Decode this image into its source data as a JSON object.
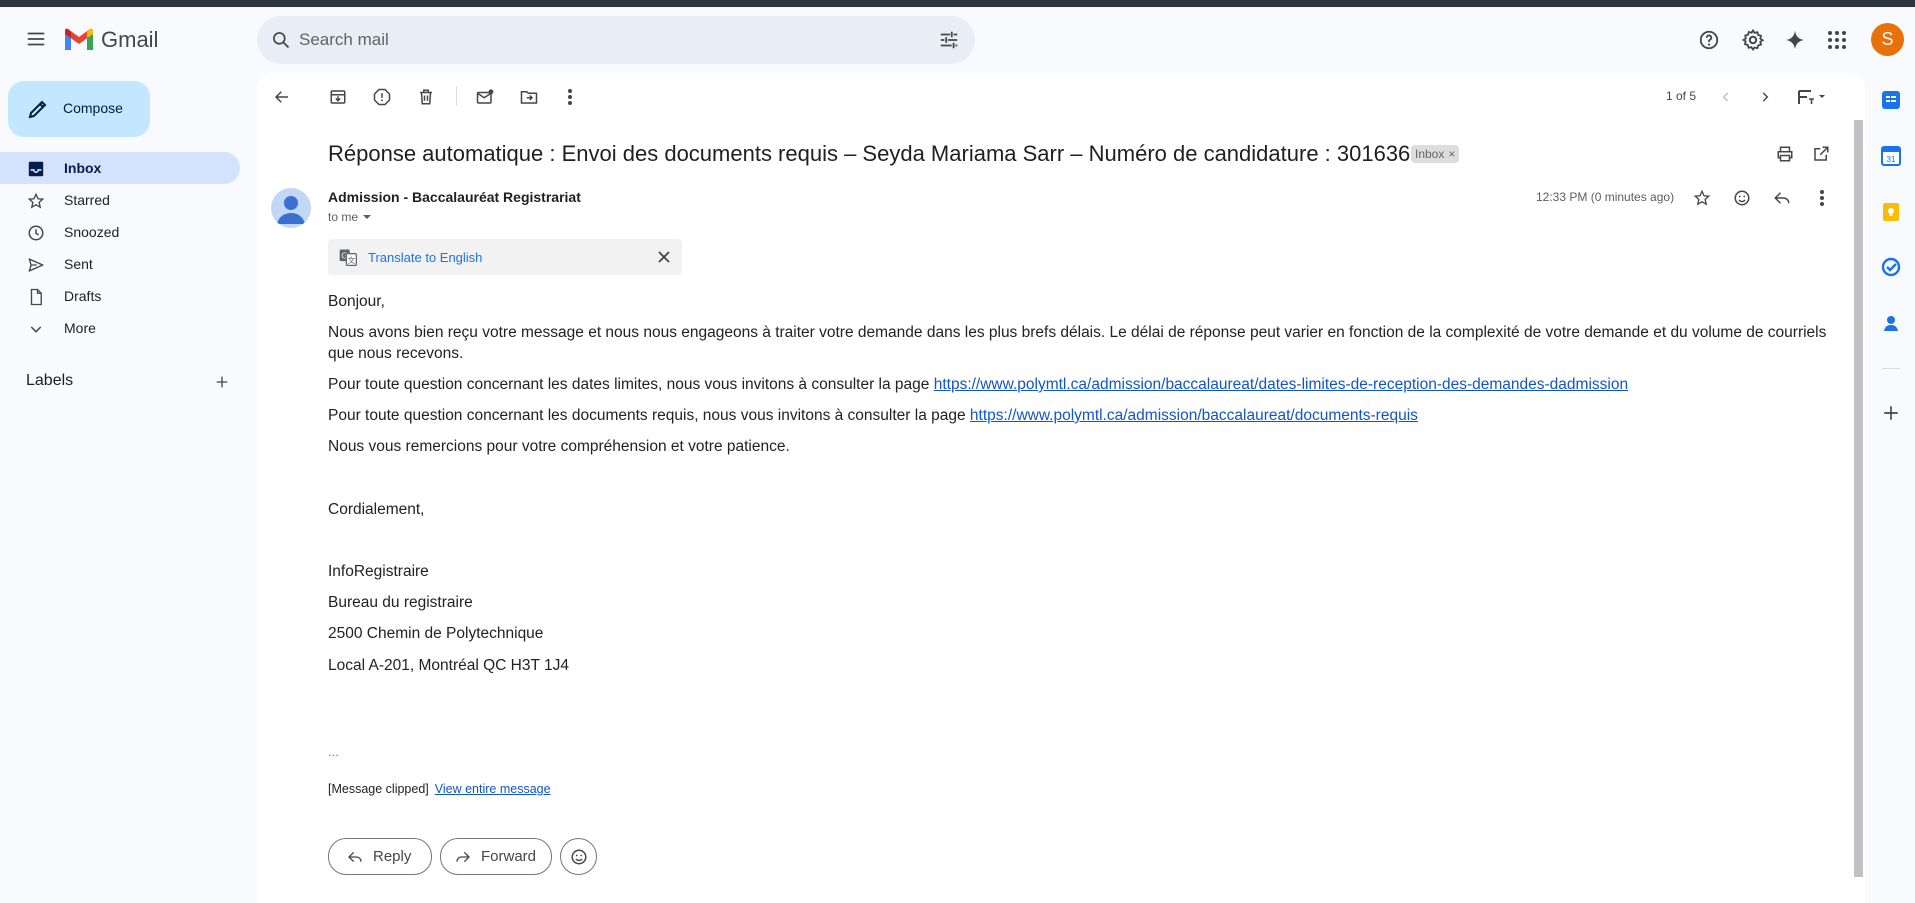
{
  "header": {
    "app_name": "Gmail",
    "search_placeholder": "Search mail",
    "avatar_letter": "S"
  },
  "sidebar": {
    "compose_label": "Compose",
    "items": [
      {
        "label": "Inbox",
        "icon": "inbox-icon",
        "active": true
      },
      {
        "label": "Starred",
        "icon": "star-icon"
      },
      {
        "label": "Snoozed",
        "icon": "clock-icon"
      },
      {
        "label": "Sent",
        "icon": "send-icon"
      },
      {
        "label": "Drafts",
        "icon": "draft-icon"
      },
      {
        "label": "More",
        "icon": "chevron-down-icon"
      }
    ],
    "labels_title": "Labels"
  },
  "toolbar": {
    "pager": "1 of 5"
  },
  "email": {
    "subject": "Réponse automatique : Envoi des documents requis – Seyda Mariama Sarr – Numéro de candidature : 301636",
    "label_chip": "Inbox",
    "sender": "Admission - Baccalauréat Registrariat",
    "recipient": "to me",
    "timestamp": "12:33 PM (0 minutes ago)",
    "translate_link": "Translate to English",
    "body": {
      "greeting": "Bonjour,",
      "para1": "Nous avons bien reçu votre message et nous nous engageons à traiter votre demande dans les plus brefs délais. Le délai de réponse peut varier en fonction de la complexité de votre demande et du volume de courriels que nous recevons.",
      "para2_text": "Pour toute question concernant les dates limites, nous vous invitons à consulter la page ",
      "para2_link": "https://www.polymtl.ca/admission/baccalaureat/dates-limites-de-reception-des-demandes-dadmission",
      "para3_text": "Pour toute question concernant les documents requis, nous vous invitons à consulter la page ",
      "para3_link": "https://www.polymtl.ca/admission/baccalaureat/documents-requis",
      "para4": "Nous vous remercions pour votre compréhension et votre patience.",
      "closing": "Cordialement,",
      "sig1": "InfoRegistraire",
      "sig2": "Bureau du registraire",
      "sig3": "2500 Chemin de Polytechnique",
      "sig4": "Local A-201, Montréal QC H3T 1J4",
      "ellipsis": "...",
      "clipped_note": "[Message clipped]",
      "view_entire": "View entire message"
    },
    "reply_label": "Reply",
    "forward_label": "Forward"
  },
  "colors": {
    "accent": "#1a73e8",
    "compose_bg": "#c2e7ff",
    "active_nav": "#d3e3fd",
    "avatar_bg": "#e8710a"
  }
}
